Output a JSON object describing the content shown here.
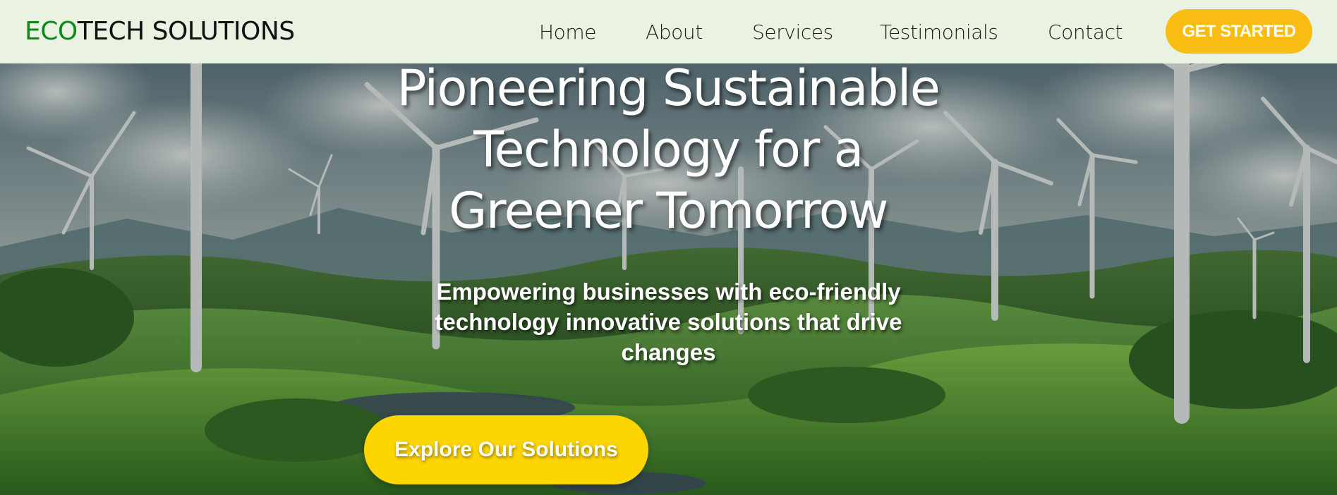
{
  "nav": {
    "logo_part1": "ECO",
    "logo_part2": "TECH SOLUTIONS",
    "links": [
      "Home",
      "About",
      "Services",
      "Testimonials",
      "Contact"
    ],
    "cta_label": "GET STARTED"
  },
  "hero": {
    "title_lines": [
      "Pioneering Sustainable",
      "Technology for a",
      "Greener Tomorrow"
    ],
    "subtitle_lines": [
      "Empowering businesses with eco-friendly",
      "technology innovative solutions that drive",
      "changes"
    ],
    "button_label": "Explore Our Solutions",
    "background_icon": "wind-farm-landscape-image"
  },
  "colors": {
    "navbar_bg": "#eaf3e2",
    "logo_accent": "#0a8a1a",
    "cta_bg": "#f8bc13",
    "hero_button_bg": "#fdd500"
  }
}
